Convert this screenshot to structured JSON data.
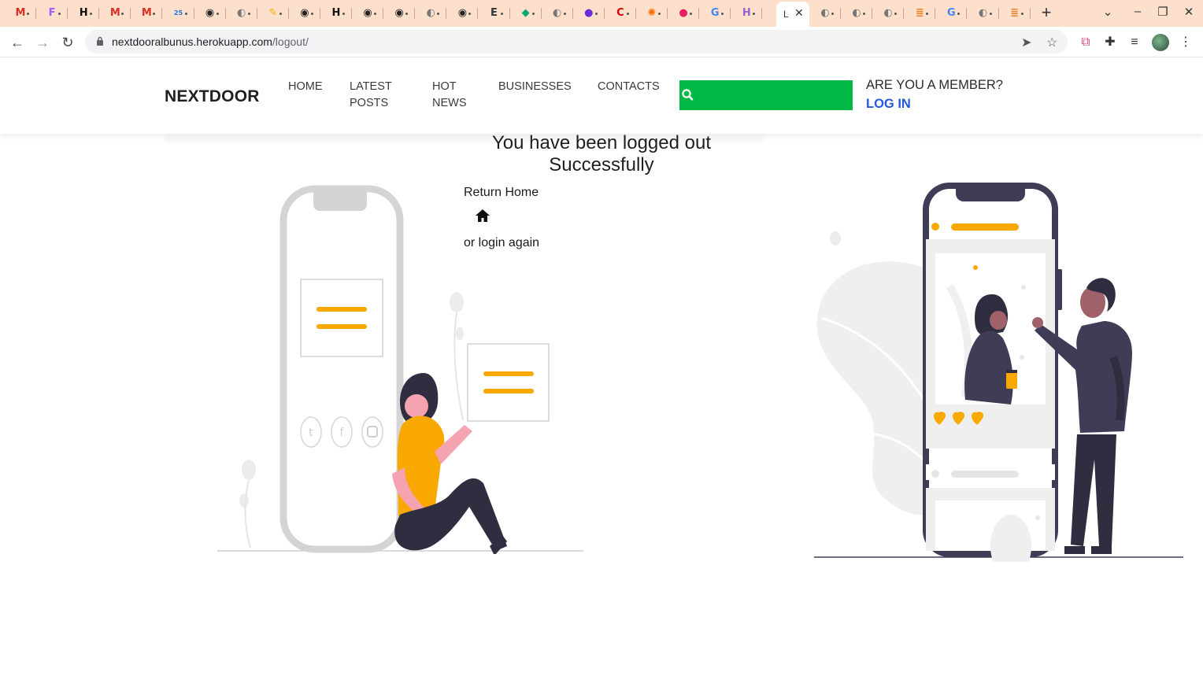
{
  "browser": {
    "tabs": [
      {
        "icon": "gmail-icon",
        "color": "#d93025",
        "glyph": "M"
      },
      {
        "icon": "figma-icon",
        "color": "#a259ff",
        "glyph": "F"
      },
      {
        "icon": "hackerrank-icon",
        "color": "#111111",
        "glyph": "H"
      },
      {
        "icon": "gmail-icon",
        "color": "#d93025",
        "glyph": "M"
      },
      {
        "icon": "gmail-icon",
        "color": "#d93025",
        "glyph": "M"
      },
      {
        "icon": "calendar-icon",
        "color": "#1a73e8",
        "glyph": "25"
      },
      {
        "icon": "github-icon",
        "color": "#222222",
        "glyph": "◉"
      },
      {
        "icon": "globe-icon",
        "color": "#777777",
        "glyph": "◐"
      },
      {
        "icon": "pin-icon",
        "color": "#f9ab00",
        "glyph": "✎"
      },
      {
        "icon": "github-icon",
        "color": "#222222",
        "glyph": "◉"
      },
      {
        "icon": "hackerrank-icon",
        "color": "#111111",
        "glyph": "H"
      },
      {
        "icon": "github-icon",
        "color": "#222222",
        "glyph": "◉"
      },
      {
        "icon": "github-icon",
        "color": "#222222",
        "glyph": "◉"
      },
      {
        "icon": "globe-icon",
        "color": "#777777",
        "glyph": "◐"
      },
      {
        "icon": "github-icon",
        "color": "#222222",
        "glyph": "◉"
      },
      {
        "icon": "audio-tab-icon",
        "color": "#333333",
        "glyph": "E"
      },
      {
        "icon": "shield-icon",
        "color": "#00a86b",
        "glyph": "◆"
      },
      {
        "icon": "globe-icon",
        "color": "#777777",
        "glyph": "◐"
      },
      {
        "icon": "circle-icon",
        "color": "#6c2bd9",
        "glyph": "●"
      },
      {
        "icon": "c-icon",
        "color": "#d50000",
        "glyph": "C"
      },
      {
        "icon": "pinwheel-icon",
        "color": "#ff6d00",
        "glyph": "✺"
      },
      {
        "icon": "dot-icon",
        "color": "#e91e63",
        "glyph": "●"
      },
      {
        "icon": "google-icon",
        "color": "#4285f4",
        "glyph": "G"
      },
      {
        "icon": "heroku-icon",
        "color": "#9c5fd0",
        "glyph": "H"
      }
    ],
    "active_tab_letter": "L",
    "tabs_after": [
      {
        "icon": "globe-icon",
        "color": "#777777",
        "glyph": "◐"
      },
      {
        "icon": "globe-icon",
        "color": "#777777",
        "glyph": "◐"
      },
      {
        "icon": "globe-icon",
        "color": "#777777",
        "glyph": "◐"
      },
      {
        "icon": "stackoverflow-icon",
        "color": "#f48024",
        "glyph": "≣"
      },
      {
        "icon": "google-icon",
        "color": "#4285f4",
        "glyph": "G"
      },
      {
        "icon": "globe-icon",
        "color": "#777777",
        "glyph": "◐"
      },
      {
        "icon": "stackoverflow-icon",
        "color": "#f48024",
        "glyph": "≣"
      }
    ],
    "url_host": "nextdooralbunus.herokuapp.com",
    "url_path": "/logout/"
  },
  "site": {
    "logo": "NEXTDOOR",
    "nav": {
      "home": "HOME",
      "latest_posts": "LATEST POSTS",
      "hot_news": "HOT NEWS",
      "businesses": "BUSINESSES",
      "contacts": "CONTACTS"
    },
    "search_placeholder": "",
    "member_question": "ARE YOU A MEMBER?",
    "login_label": "LOG IN"
  },
  "main": {
    "title": "You have been logged out Successfully",
    "return_home": "Return Home",
    "login_again": "or login again"
  },
  "colors": {
    "accent_green": "#00b846",
    "link_blue": "#2557e0",
    "illustration_yellow": "#f9a800",
    "illustration_purple": "#3f3d56",
    "tab_strip": "#fde0cc"
  }
}
